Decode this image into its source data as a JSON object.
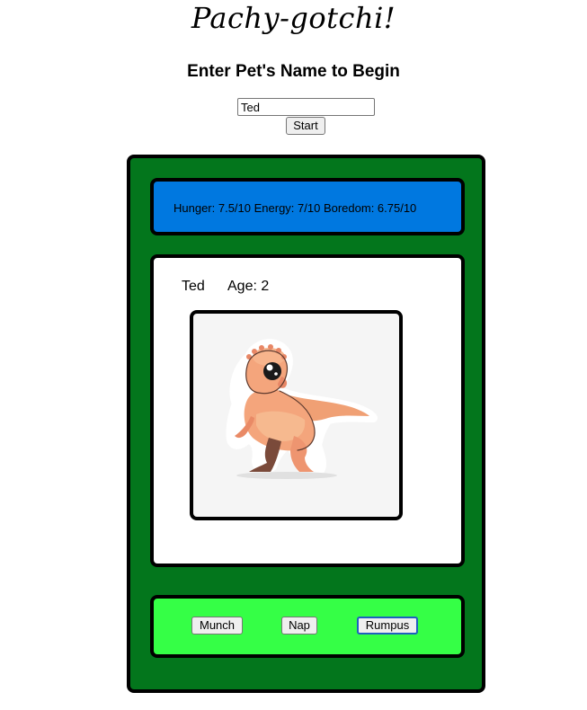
{
  "header": {
    "title": "Pachy-gotchi!",
    "subtitle": "Enter Pet's Name to Begin"
  },
  "name_form": {
    "input_value": "Ted",
    "start_label": "Start"
  },
  "stats": {
    "text": "Hunger: 7.5/10 Energy: 7/10 Boredom: 6.75/10"
  },
  "pet": {
    "name": "Ted",
    "age_text": "Age: 2",
    "image": "pachycephalosaurus-sticker"
  },
  "controls": {
    "munch_label": "Munch",
    "nap_label": "Nap",
    "rumpus_label": "Rumpus"
  },
  "colors": {
    "device": "#03761c",
    "stats_panel": "#0078e0",
    "screen": "#ffffff",
    "controls_panel": "#35ff46",
    "pet_orange": "#f4a07a",
    "pet_brown": "#7a4a3a"
  }
}
